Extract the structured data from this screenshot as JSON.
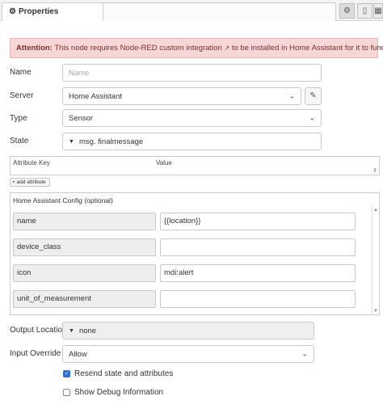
{
  "tab": {
    "label": "Properties"
  },
  "banner": {
    "prefix": "Attention:",
    "text": " This node requires Node-RED custom integration",
    "suffix": " to be installed in Home Assistant for it to function."
  },
  "form": {
    "name_label": "Name",
    "name_placeholder": "Name",
    "server_label": "Server",
    "server_value": "Home Assistant",
    "type_label": "Type",
    "type_value": "Sensor",
    "state_label": "State",
    "state_type": "msg.",
    "state_value": "finalmessage"
  },
  "attributes": {
    "key_header": "Attribute Key",
    "value_header": "Value",
    "add_label": "add attribute"
  },
  "ha_config": {
    "title": "Home Assistant Config (optional)",
    "rows": [
      {
        "key": "name",
        "value": "{{location}}"
      },
      {
        "key": "device_class",
        "value": ""
      },
      {
        "key": "icon",
        "value": "mdi:alert"
      },
      {
        "key": "unit_of_measurement",
        "value": ""
      }
    ]
  },
  "output": {
    "location_label": "Output Location",
    "location_value": "none",
    "override_label": "Input Override",
    "override_value": "Allow"
  },
  "checkboxes": {
    "resend_label": "Resend state and attributes",
    "resend_checked": true,
    "debug_label": "Show Debug Information",
    "debug_checked": false
  },
  "colors": {
    "banner_bg": "#f6d6d6",
    "banner_text": "#7a2f2f",
    "checkbox_on": "#2d6fd1"
  }
}
